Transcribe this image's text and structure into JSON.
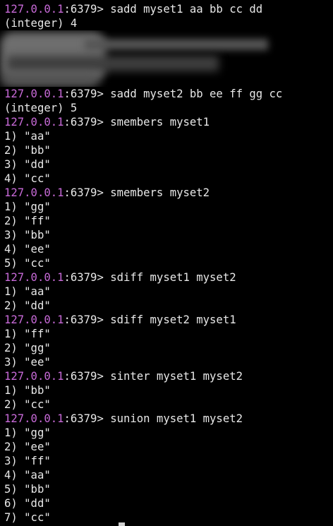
{
  "prompt": {
    "host": "127.0.0.1",
    "port_suffix": ":6379> "
  },
  "session": [
    {
      "cmd": "sadd myset1 aa bb cc dd",
      "out": [
        "(integer) 4"
      ]
    },
    {
      "cmd": "sadd myset2 bb ee ff gg cc",
      "out": [
        "(integer) 5"
      ]
    },
    {
      "cmd": "smembers myset1",
      "out": [
        "1) \"aa\"",
        "2) \"bb\"",
        "3) \"dd\"",
        "4) \"cc\""
      ]
    },
    {
      "cmd": "smembers myset2",
      "out": [
        "1) \"gg\"",
        "2) \"ff\"",
        "3) \"bb\"",
        "4) \"ee\"",
        "5) \"cc\""
      ]
    },
    {
      "cmd": "sdiff myset1 myset2",
      "out": [
        "1) \"aa\"",
        "2) \"dd\""
      ]
    },
    {
      "cmd": "sdiff myset2 myset1",
      "out": [
        "1) \"ff\"",
        "2) \"gg\"",
        "3) \"ee\""
      ]
    },
    {
      "cmd": "sinter myset1 myset2",
      "out": [
        "1) \"bb\"",
        "2) \"cc\""
      ]
    },
    {
      "cmd": "sunion myset1 myset2",
      "out": [
        "1) \"gg\"",
        "2) \"ee\"",
        "3) \"ff\"",
        "4) \"aa\"",
        "5) \"bb\"",
        "6) \"dd\"",
        "7) \"cc\""
      ]
    }
  ],
  "colors": {
    "prompt_host": "#c86ad8",
    "text": "#e8e8e8",
    "background": "#000000"
  }
}
